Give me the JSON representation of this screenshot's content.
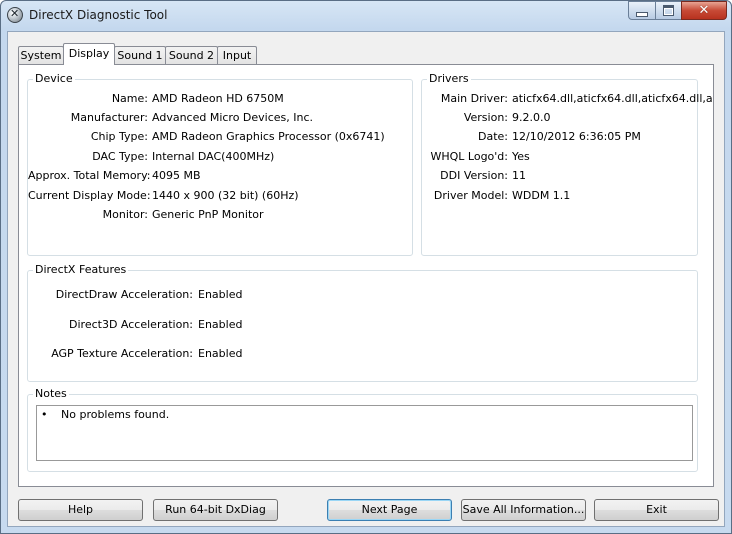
{
  "window": {
    "title": "DirectX Diagnostic Tool"
  },
  "tabs": [
    "System",
    "Display",
    "Sound 1",
    "Sound 2",
    "Input"
  ],
  "device": {
    "label": "Device",
    "rows": [
      {
        "key": "Name:",
        "value": "AMD Radeon HD 6750M"
      },
      {
        "key": "Manufacturer:",
        "value": "Advanced Micro Devices, Inc."
      },
      {
        "key": "Chip Type:",
        "value": "AMD Radeon Graphics Processor (0x6741)"
      },
      {
        "key": "DAC Type:",
        "value": "Internal DAC(400MHz)"
      },
      {
        "key": "Approx. Total Memory:",
        "value": "4095 MB"
      },
      {
        "key": "Current Display Mode:",
        "value": "1440 x 900 (32 bit) (60Hz)"
      },
      {
        "key": "Monitor:",
        "value": "Generic PnP Monitor"
      }
    ]
  },
  "drivers": {
    "label": "Drivers",
    "rows": [
      {
        "key": "Main Driver:",
        "value": "aticfx64.dll,aticfx64.dll,aticfx64.dll,a"
      },
      {
        "key": "Version:",
        "value": "9.2.0.0"
      },
      {
        "key": "Date:",
        "value": "12/10/2012 6:36:05 PM"
      },
      {
        "key": "WHQL Logo'd:",
        "value": "Yes"
      },
      {
        "key": "DDI Version:",
        "value": "11"
      },
      {
        "key": "Driver Model:",
        "value": "WDDM 1.1"
      }
    ]
  },
  "features": {
    "label": "DirectX Features",
    "rows": [
      {
        "key": "DirectDraw Acceleration:",
        "value": "Enabled"
      },
      {
        "key": "Direct3D Acceleration:",
        "value": "Enabled"
      },
      {
        "key": "AGP Texture Acceleration:",
        "value": "Enabled"
      }
    ]
  },
  "notes": {
    "label": "Notes",
    "bullet": "•",
    "text": "No problems found."
  },
  "buttons": {
    "help": "Help",
    "run64": "Run 64-bit DxDiag",
    "next_page": "Next Page",
    "save_all": "Save All Information...",
    "exit": "Exit"
  }
}
